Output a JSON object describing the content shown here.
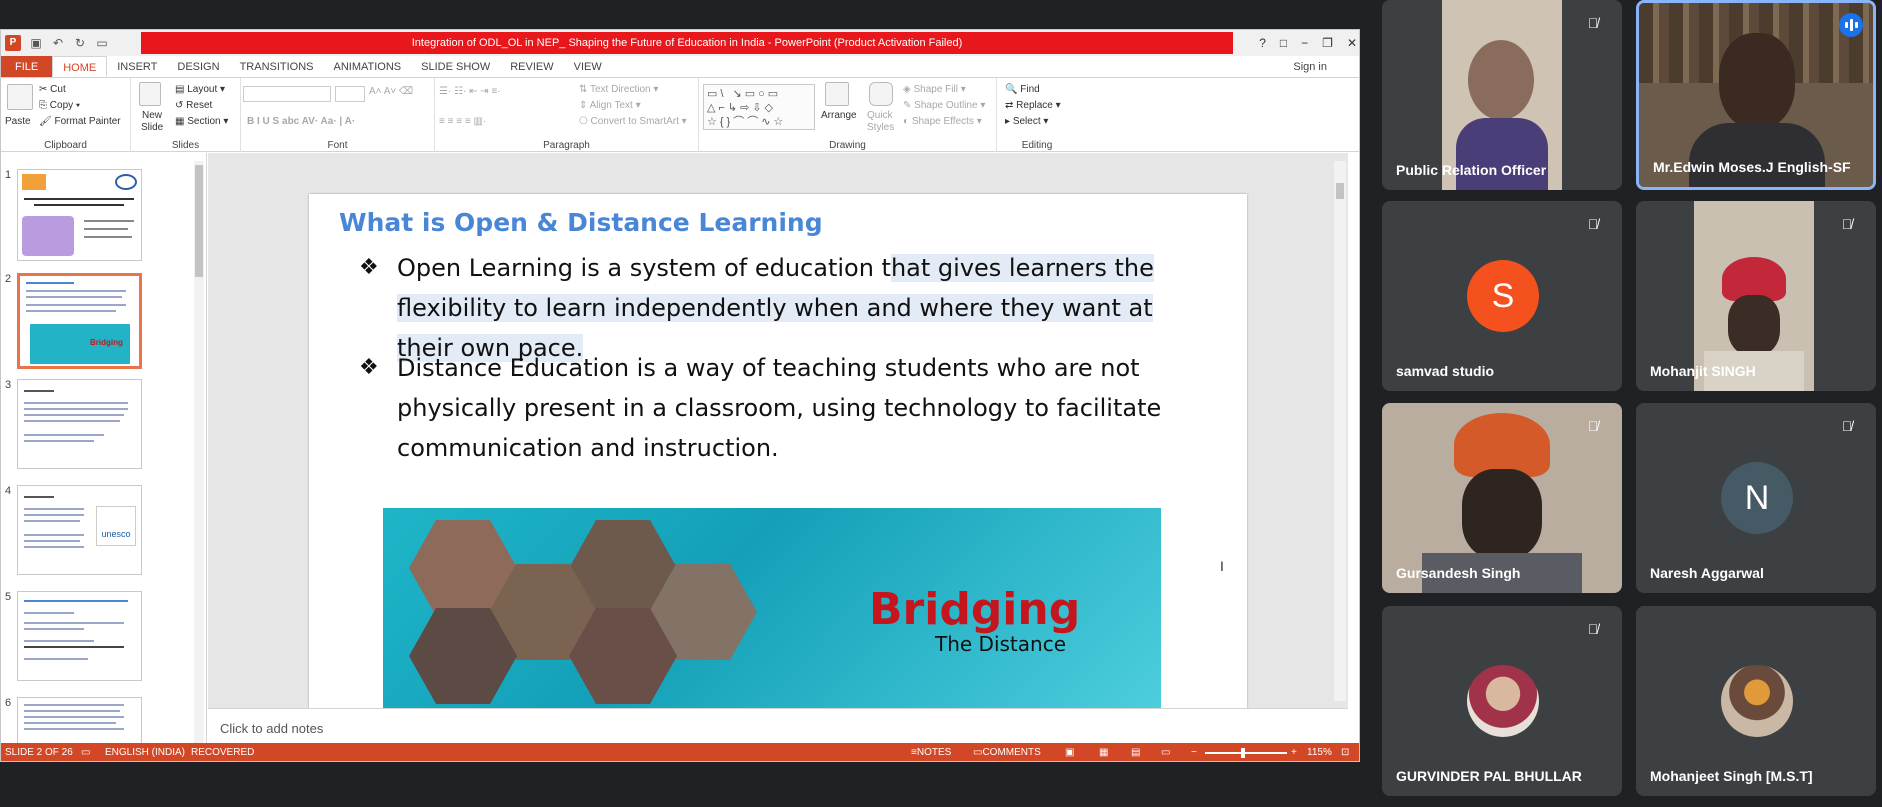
{
  "ppt": {
    "window_title": "Integration of ODL_OL in NEP_ Shaping the Future of Education in India - PowerPoint (Product Activation Failed)",
    "window_controls": [
      "?",
      "□",
      "−",
      "❐",
      "✕"
    ],
    "tabs": [
      "FILE",
      "HOME",
      "INSERT",
      "DESIGN",
      "TRANSITIONS",
      "ANIMATIONS",
      "SLIDE SHOW",
      "REVIEW",
      "VIEW"
    ],
    "sign_in": "Sign in",
    "ribbon": {
      "clipboard": {
        "label": "Clipboard",
        "paste": "Paste",
        "cut": "Cut",
        "copy": "Copy",
        "format_painter": "Format Painter"
      },
      "slides": {
        "label": "Slides",
        "new_slide": "New Slide",
        "layout": "Layout",
        "reset": "Reset",
        "section": "Section"
      },
      "font": {
        "label": "Font"
      },
      "paragraph": {
        "label": "Paragraph",
        "text_direction": "Text Direction",
        "align_text": "Align Text",
        "convert_smartart": "Convert to SmartArt"
      },
      "drawing": {
        "label": "Drawing",
        "arrange": "Arrange",
        "quick_styles": "Quick Styles",
        "shape_fill": "Shape Fill",
        "shape_outline": "Shape Outline",
        "shape_effects": "Shape Effects"
      },
      "editing": {
        "label": "Editing",
        "find": "Find",
        "replace": "Replace",
        "select": "Select"
      }
    },
    "thumbnails": [
      "1",
      "2",
      "3",
      "4",
      "5",
      "6"
    ],
    "slide": {
      "title": "What is Open & Distance Learning",
      "bullet_mark": "❖",
      "bullets": [
        "Open Learning is a system of education that gives learners the flexibility to learn independently when and where they want at their own pace.",
        "Distance Education is a way of teaching students who are not physically present in a classroom, using technology to facilitate communication and instruction."
      ],
      "banner_title": "Bridging",
      "banner_subtitle": "The Distance"
    },
    "notes_placeholder": "Click to add notes",
    "status": {
      "slide_count": "SLIDE 2 OF 26",
      "language": "ENGLISH (INDIA)",
      "recovered": "RECOVERED",
      "notes": "NOTES",
      "comments": "COMMENTS",
      "zoom": "115%"
    }
  },
  "participants": [
    {
      "name": "Public Relation Officer",
      "kind": "video",
      "muted": true,
      "active": false
    },
    {
      "name": "Mr.Edwin Moses.J English-SF",
      "kind": "video",
      "muted": false,
      "active": true
    },
    {
      "name": "samvad studio",
      "kind": "letter",
      "letter": "S",
      "color": "#f4511e",
      "muted": true,
      "active": false
    },
    {
      "name": "Mohanjit SINGH",
      "kind": "video",
      "muted": true,
      "active": false
    },
    {
      "name": "Gursandesh Singh",
      "kind": "video",
      "muted": true,
      "active": false
    },
    {
      "name": "Naresh Aggarwal",
      "kind": "letter",
      "letter": "N",
      "color": "#455a64",
      "muted": true,
      "active": false
    },
    {
      "name": "GURVINDER PAL BHULLAR",
      "kind": "avatar",
      "muted": true,
      "active": false
    },
    {
      "name": "Mohanjeet Singh [M.S.T]",
      "kind": "avatar",
      "muted": false,
      "active": false
    }
  ],
  "icons": {
    "mute": "mic-off-icon",
    "speaking": "speaking-indicator-icon"
  }
}
